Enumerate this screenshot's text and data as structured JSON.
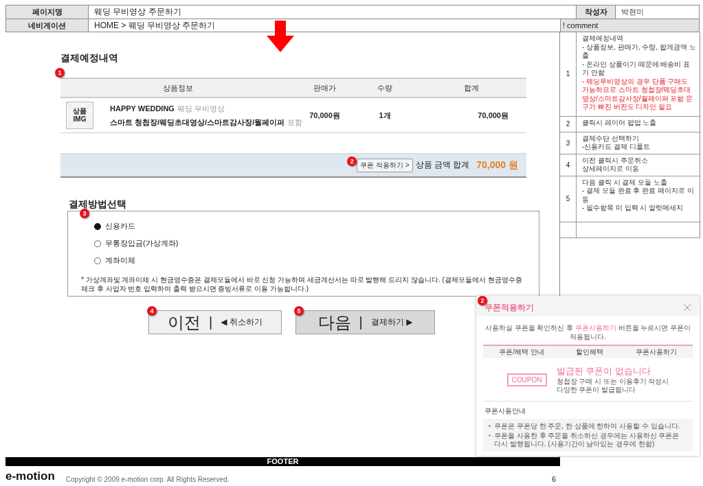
{
  "header": {
    "page_label": "페이지명",
    "page_name": "웨딩 무비영상 주문하기",
    "author_label": "작성자",
    "author": "박현미",
    "nav_label": "네비게이션",
    "nav": "HOME > 웨딩 무비영상 주문하기",
    "comment_label": "! comment"
  },
  "order": {
    "badge": "1",
    "title": "결제예정내역",
    "columns": [
      "상품정보",
      "판매가",
      "수량",
      "합계"
    ],
    "product": {
      "image_label": "상품 IMG",
      "name": "HAPPY WEDDING",
      "category": "웨딩 무비영상",
      "items": "스마트 청첩장/웨딩초대영상/스마트감사장/월페이퍼",
      "items_suffix": "포함",
      "price": "70,000원",
      "quantity": "1개",
      "total": "70,000원"
    },
    "summary": {
      "badge": "2",
      "coupon_button": "쿠폰 적용하기 >",
      "label": "상품 금액 합계",
      "amount": "70,000 원"
    }
  },
  "payment": {
    "badge": "3",
    "title": "결제방법선택",
    "options": [
      {
        "label": "신용카드",
        "selected": true
      },
      {
        "label": "무통장입금(가상계좌)",
        "selected": false
      },
      {
        "label": "계좌이체",
        "selected": false
      }
    ],
    "note": "* 가상계좌및 계좌이체 시 현금영수증은 결제모듈에서 바로 신청 가능하며 세금계산서는 따로 발행해 드리지 않습니다. (결제모듈에서 현금영수증 체크 후  사업자 번호 입력하여 출력 받으시면 증빙서류로 이용 가능합니다.)"
  },
  "buttons": [
    {
      "kind": "prev",
      "badge": "4",
      "label": "이전",
      "separator": "|",
      "sub": "◀ 취소하기"
    },
    {
      "kind": "next",
      "badge": "5",
      "label": "다음",
      "separator": "|",
      "sub": "결제하기 ▶"
    }
  ],
  "comments": [
    {
      "number": "1",
      "lines": [
        {
          "text": "결제예정내역",
          "kind": "normal"
        },
        {
          "text": "- 상품정보, 판매가, 수량, 합계금액 노출",
          "kind": "normal"
        },
        {
          "text": "- 온라인 상품이기 때문에 배송비 표기 안함",
          "kind": "normal"
        },
        {
          "text": "- 웨딩무비영상의 경우 단품 구매도 가능하므로 스마트 청첩장/웨딩초대영상/스마트감사장/월페이퍼 포함 문구가 빠진 버전도 디자인 필요",
          "kind": "highlight"
        }
      ]
    },
    {
      "number": "2",
      "lines": [
        {
          "text": "클릭시 레이어 팝업 노출",
          "kind": "normal"
        }
      ]
    },
    {
      "number": "3",
      "lines": [
        {
          "text": "결제수단 선택하기",
          "kind": "normal"
        },
        {
          "text": "-신용카드 결제 디폴트",
          "kind": "normal"
        }
      ]
    },
    {
      "number": "4",
      "lines": [
        {
          "text": "이전 클릭시 주문취소",
          "kind": "normal"
        },
        {
          "text": "상세페이지로 이동",
          "kind": "normal"
        }
      ]
    },
    {
      "number": "5",
      "lines": [
        {
          "text": "다음 클릭 시 결제 모듈 노출",
          "kind": "normal"
        },
        {
          "text": "- 결제 모듈 완료 후 완료 페이지로 이동",
          "kind": "normal"
        },
        {
          "text": "- 필수항목 미 입력 시 알럿메세지",
          "kind": "normal"
        }
      ]
    }
  ],
  "popup": {
    "badge": "2",
    "title": "쿠폰적용하기",
    "intro": [
      {
        "text": "사용하실 쿠폰을 확인하신 후 ",
        "highlight": false
      },
      {
        "text": "쿠폰사용하기",
        "highlight": true
      },
      {
        "text": " 버튼을 누르시면 쿠폰이 적용됩니다.",
        "highlight": false
      }
    ],
    "columns": [
      "쿠폰/혜택 안내",
      "할인혜택",
      "쿠폰사용하기"
    ],
    "empty": {
      "ticket": "COUPON",
      "title": "발급된 쿠폰이 없습니다",
      "lines": [
        "청첩장 구매 시 또는 이용후기 작성시",
        "다양한 쿠폰이 발급됩니다"
      ]
    },
    "guide_title": "쿠폰사용안내",
    "guide": [
      "쿠폰은 쿠폰당 한 주문, 한 상품에 한하여 사용할 수 있습니다.",
      "쿠폰을 사용한 후 주문을 취소하신 경우에는 사용하신 쿠폰은 다시 발행됩니다. (사용기간이 남아있는 경우에 한함)"
    ]
  },
  "footer": {
    "label": "FOOTER",
    "logo": "e-motion",
    "copyright": "Copyright © 2009 e-motion corp. All Rights Reserved.",
    "page": "6"
  }
}
